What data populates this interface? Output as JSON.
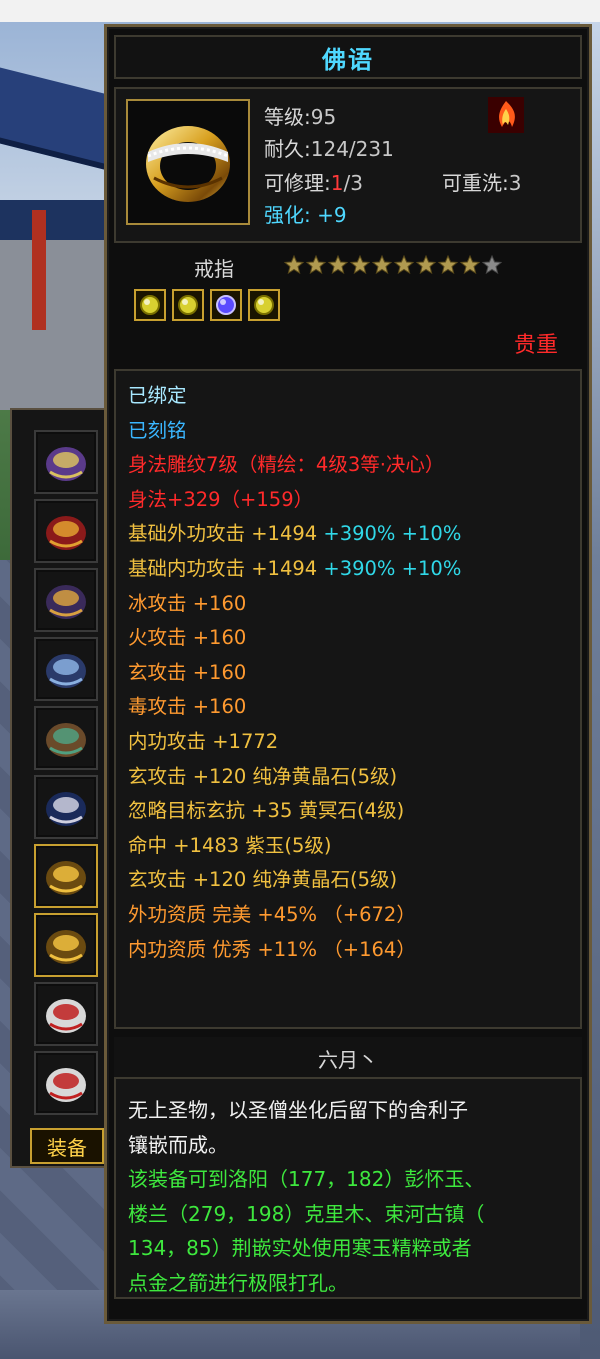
{
  "item": {
    "title": "佛语",
    "level_label": "等级:",
    "level": "95",
    "durability_label": "耐久:",
    "durability": "124/231",
    "repair_label": "可修理:",
    "repair_used": "1",
    "repair_total": "/3",
    "rewash_label": "可重洗:",
    "rewash": "3",
    "refine_label": "强化:",
    "refine": "+9",
    "type": "戒指",
    "stars_filled": 9,
    "stars_total": 10,
    "rarity": "贵重",
    "set_icon": "flame-emblem-icon",
    "gems": [
      "yellow-gem-icon",
      "yellow-gem-icon",
      "purple-gem-icon",
      "yellow-gem-icon"
    ]
  },
  "attributes": [
    {
      "text": "已绑定",
      "color": "#a8e8ff"
    },
    {
      "text": "已刻铭",
      "color": "#3ab6ff"
    },
    {
      "text": "身法雕纹7级（精绘：4级3等·决心）",
      "color": "#ff2a2a"
    },
    {
      "text": "身法+329（+159）",
      "color": "#ff2a2a"
    },
    {
      "text": "基础外功攻击 +1494",
      "extra1": "+390%",
      "extra2": "+10%",
      "color": "#f0c040"
    },
    {
      "text": "基础内功攻击 +1494",
      "extra1": "+390%",
      "extra2": "+10%",
      "color": "#f0c040"
    },
    {
      "text": "冰攻击 +160",
      "color": "#ff9a30"
    },
    {
      "text": "火攻击 +160",
      "color": "#ff9a30"
    },
    {
      "text": "玄攻击 +160",
      "color": "#ff9a30"
    },
    {
      "text": "毒攻击 +160",
      "color": "#ff9a30"
    },
    {
      "text": "内功攻击 +1772",
      "color": "#f0c040"
    },
    {
      "text": "玄攻击 +120 纯净黄晶石(5级)",
      "color": "#f0c040"
    },
    {
      "text": "忽略目标玄抗 +35 黄冥石(4级)",
      "color": "#f0c040"
    },
    {
      "text": "命中 +1483 紫玉(5级)",
      "color": "#f0c040"
    },
    {
      "text": "玄攻击 +120 纯净黄晶石(5级)",
      "color": "#f0c040"
    },
    {
      "text": "外功资质  完美 +45% （+672）",
      "color": "#ff9a30"
    },
    {
      "text": "内功资质  优秀 +11% （+164）",
      "color": "#ff9a30"
    }
  ],
  "maker": "六月丶",
  "description": {
    "lore": [
      "无上圣物，以圣僧坐化后留下的舍利子",
      "镶嵌而成。"
    ],
    "hint": [
      "该装备可到洛阳（177，182）彭怀玉、",
      "楼兰（279，198）克里木、束河古镇（",
      "134，85）荆嵌实处使用寒玉精粹或者",
      "点金之箭进行极限打孔。"
    ]
  },
  "sidebar": {
    "tab_label": "装备",
    "slots": [
      "necklace-icon",
      "amulet-scroll-icon",
      "bracer-icon",
      "gauntlet-icon",
      "belt-icon",
      "boots-icon",
      "ring-icon",
      "ring-icon",
      "charm-icon",
      "charm-icon"
    ],
    "active_slots": [
      6,
      7
    ]
  },
  "colors": {
    "title": "#4fd8ff",
    "rarity": "#ff2a2a",
    "border_gold": "#c8a030"
  }
}
